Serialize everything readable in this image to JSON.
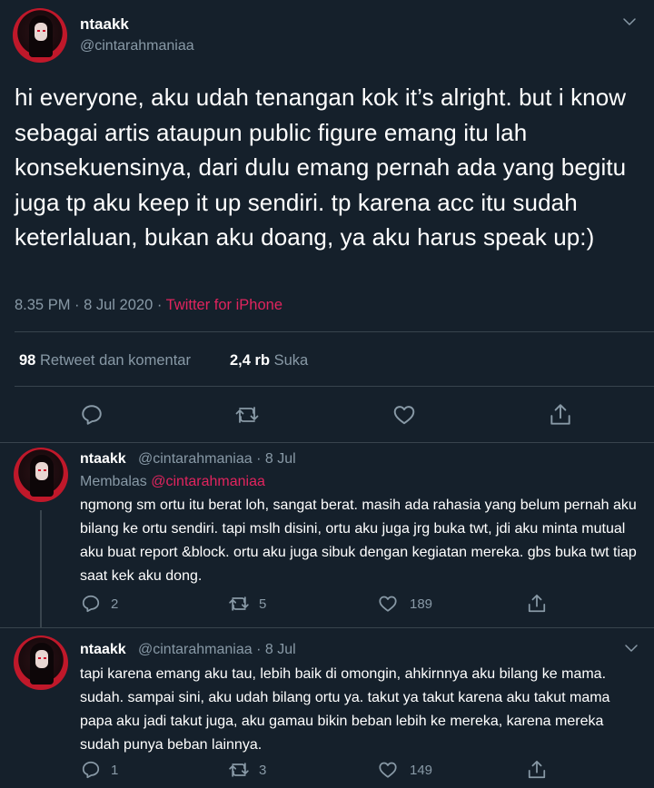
{
  "main_tweet": {
    "name": "ntaakk",
    "handle": "@cintarahmaniaa",
    "text": "hi everyone, aku udah tenangan kok it’s alright. but i know sebagai artis ataupun public figure emang itu lah konsekuensinya, dari dulu emang pernah ada yang begitu juga tp aku keep it up sendiri. tp karena acc itu sudah keterlaluan, bukan aku doang, ya aku harus speak up:)",
    "timestamp": "8.35 PM · 8 Jul 2020 · ",
    "source": "Twitter for iPhone",
    "retweets_count": "98",
    "retweets_label": "Retweet dan komentar",
    "likes_count": "2,4 rb",
    "likes_label": "Suka"
  },
  "replies": [
    {
      "name": "ntaakk",
      "meta": "@cintarahmaniaa · 8 Jul",
      "replying_prefix": "Membalas ",
      "replying_to": "@cintarahmaniaa",
      "text": "ngmong sm ortu itu berat loh, sangat berat. masih ada rahasia yang belum pernah aku bilang ke ortu sendiri. tapi mslh disini, ortu aku juga jrg buka twt, jdi aku minta mutual aku buat report &block. ortu aku juga sibuk dengan kegiatan mereka. gbs buka twt tiap saat kek aku dong.",
      "reply_count": "2",
      "retweet_count": "5",
      "like_count": "189"
    },
    {
      "name": "ntaakk",
      "meta": "@cintarahmaniaa · 8 Jul",
      "text": "tapi karena emang aku tau, lebih baik di omongin, ahkirnnya aku bilang ke mama. sudah. sampai sini, aku udah bilang ortu ya. takut ya takut karena aku takut mama papa aku jadi takut juga, aku gamau bikin beban lebih ke mereka, karena mereka sudah punya beban lainnya.",
      "reply_count": "1",
      "retweet_count": "3",
      "like_count": "149"
    }
  ],
  "icons": {
    "reply": "reply-icon",
    "retweet": "retweet-icon",
    "like": "heart-icon",
    "share": "share-icon",
    "more": "chevron-down-icon"
  },
  "colors": {
    "background": "#15202b",
    "secondary_text": "#8899a6",
    "accent": "#e0245e",
    "divider": "#38444d"
  }
}
